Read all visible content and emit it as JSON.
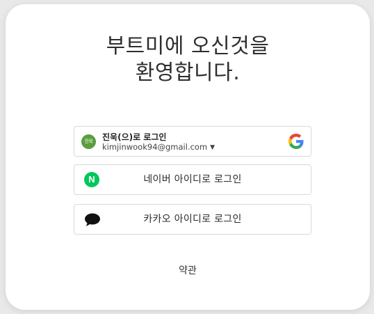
{
  "modal": {
    "title_line1": "부트미에 오신것을",
    "title_line2": "환영합니다."
  },
  "google_account": {
    "avatar_text": "진욱",
    "name_label": "진욱(으)로 로그인",
    "email": "kimjinwook94@gmail.com",
    "dropdown_icon": "chevron-down-icon",
    "logo_icon": "google-logo-icon",
    "avatar_color": "#5a9e3d"
  },
  "naver_login": {
    "icon_letter": "N",
    "label": "네이버 아이디로 로그인",
    "brand_color": "#03c75a"
  },
  "kakao_login": {
    "icon": "kakao-speech-bubble-icon",
    "label": "카카오 아이디로 로그인"
  },
  "footer": {
    "terms_label": "약관"
  }
}
